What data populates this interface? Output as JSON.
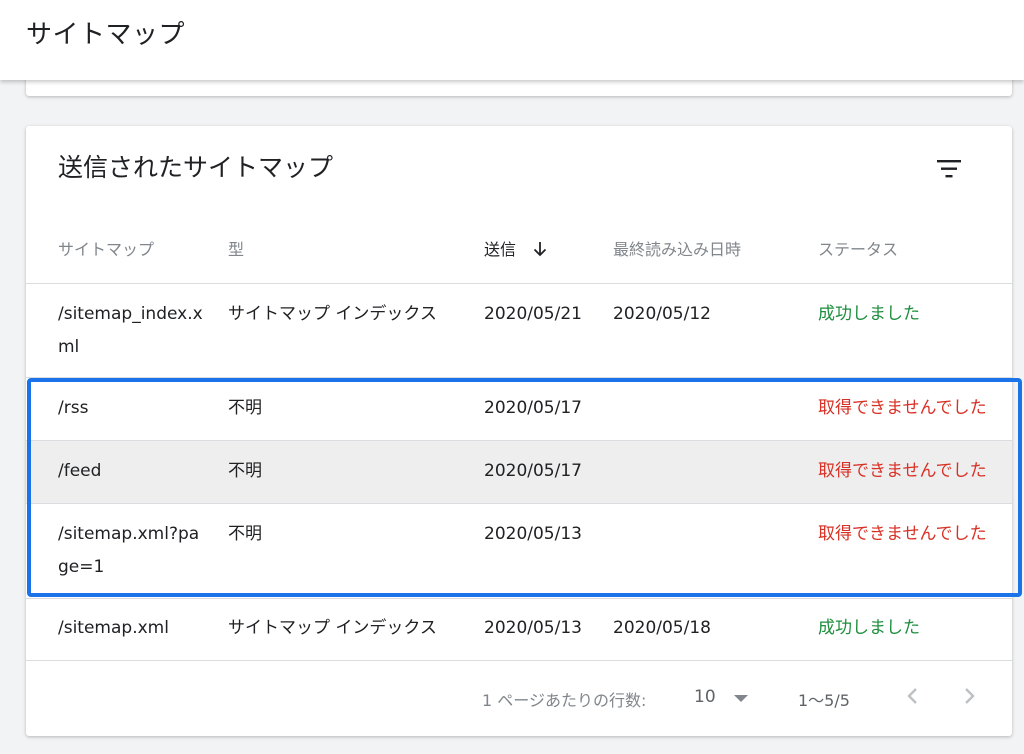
{
  "page": {
    "title": "サイトマップ"
  },
  "card": {
    "title": "送信されたサイトマップ",
    "filter_icon": "filter-icon"
  },
  "table": {
    "headers": {
      "sitemap": "サイトマップ",
      "type": "型",
      "sent": "送信",
      "last_read": "最終読み込み日時",
      "status": "ステータス"
    },
    "sort_icon": "arrow-down-icon",
    "rows": [
      {
        "sitemap": "/sitemap_index.xml",
        "type": "サイトマップ インデックス",
        "sent": "2020/05/21",
        "last_read": "2020/05/12",
        "status": "成功しました",
        "status_kind": "success"
      },
      {
        "sitemap": "/rss",
        "type": "不明",
        "sent": "2020/05/17",
        "last_read": "",
        "status": "取得できませんでした",
        "status_kind": "error"
      },
      {
        "sitemap": "/feed",
        "type": "不明",
        "sent": "2020/05/17",
        "last_read": "",
        "status": "取得できませんでした",
        "status_kind": "error"
      },
      {
        "sitemap": "/sitemap.xml?page=1",
        "type": "不明",
        "sent": "2020/05/13",
        "last_read": "",
        "status": "取得できませんでした",
        "status_kind": "error"
      },
      {
        "sitemap": "/sitemap.xml",
        "type": "サイトマップ インデックス",
        "sent": "2020/05/13",
        "last_read": "2020/05/18",
        "status": "成功しました",
        "status_kind": "success"
      }
    ]
  },
  "pagination": {
    "rows_per_page_label": "1 ページあたりの行数:",
    "rows_per_page_value": "10",
    "range": "1〜5/5"
  },
  "colors": {
    "success": "#1e8e3e",
    "error": "#d93025",
    "highlight": "#1a73e8"
  }
}
